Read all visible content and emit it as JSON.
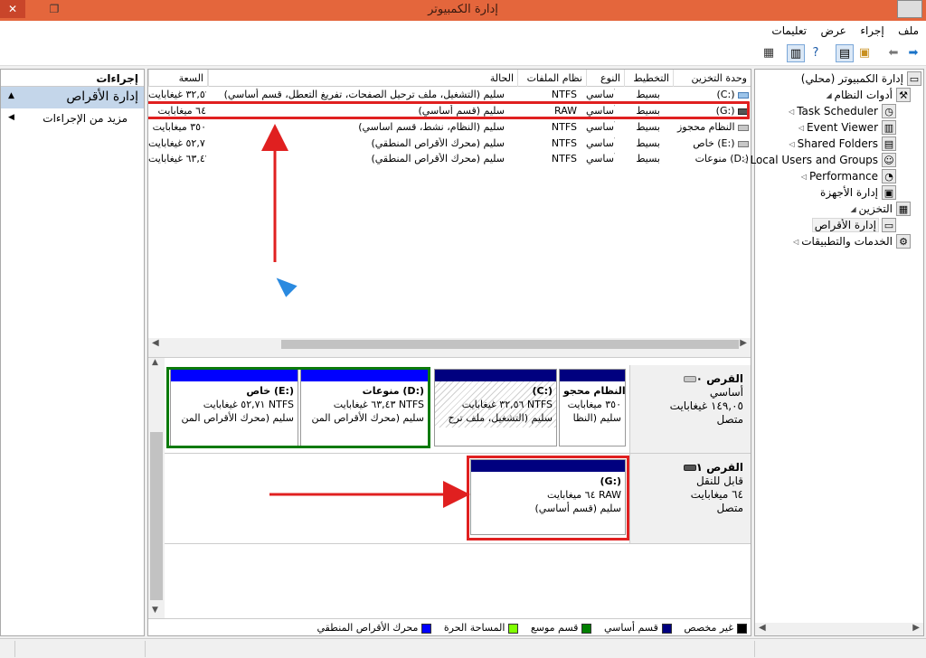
{
  "window": {
    "title": "إدارة الكمبيوتر",
    "close_glyph": "✕",
    "restore_glyph": "❐"
  },
  "menu": [
    "ملف",
    "إجراء",
    "عرض",
    "تعليمات"
  ],
  "toolbar_icons": [
    "back-arrow-icon",
    "forward-arrow-icon",
    "up-folder-icon",
    "console-tree-icon",
    "properties-icon",
    "help-icon",
    "show-hide-icon",
    "settings-icon"
  ],
  "actions": {
    "header": "إجراءات",
    "group": "إدارة الأقراص",
    "more": "مزيد من الإجراءات"
  },
  "volume_table": {
    "columns": [
      "وحدة التخزين",
      "التخطيط",
      "النوع",
      "نظام الملفات",
      "الحالة",
      "السعة"
    ],
    "rows": [
      {
        "volume": "(C:)",
        "layout": "بسيط",
        "type": "أساسي",
        "fs": "NTFS",
        "status": "سليم (التشغيل، ملف ترحيل الصفحات، تفريغ التعطل، قسم أساسي)",
        "capacity": "٣٢,٥٦ غيغابايت"
      },
      {
        "volume": "(G:)",
        "layout": "بسيط",
        "type": "أساسي",
        "fs": "RAW",
        "status": "سليم (قسم أساسي)",
        "capacity": "٦٤ ميغابايت"
      },
      {
        "volume": "النظام محجوز",
        "layout": "بسيط",
        "type": "أساسي",
        "fs": "NTFS",
        "status": "سليم (النظام، نشط، قسم اساسي)",
        "capacity": "٣٥٠ ميغابايت"
      },
      {
        "volume": "خاص (E:)",
        "layout": "بسيط",
        "type": "أساسي",
        "fs": "NTFS",
        "status": "سليم (محرك الأقراص المنطقي)",
        "capacity": "٥٢,٧١ غيغابايت"
      },
      {
        "volume": "منوعات (D:)",
        "layout": "بسيط",
        "type": "أساسي",
        "fs": "NTFS",
        "status": "سليم (محرك الأقراص المنطقي)",
        "capacity": "٦٣,٤٣ غيغابايت"
      }
    ]
  },
  "disks": [
    {
      "name": "القرص ٠",
      "type": "أساسي",
      "size": "١٤٩,٠٥ غيغابايت",
      "state": "متصل",
      "partitions": [
        {
          "title": "النظام محجو",
          "size": "٣٥٠ ميغابايت",
          "status": "سليم (النظا"
        },
        {
          "title": "(C:)",
          "size": "٣٢,٥٦ غيغابايت NTFS",
          "status": "سليم (التشغيل، ملف ترح"
        },
        {
          "title": "منوعات  (D:)",
          "size": "٦٣,٤٣ غيغابايت NTFS",
          "status": "سليم (محرك الأقراص المن"
        },
        {
          "title": "خاص  (E:)",
          "size": "٥٢,٧١ غيغابايت NTFS",
          "status": "سليم (محرك الأقراص المن"
        }
      ]
    },
    {
      "name": "القرص ١",
      "type": "قابل للنقل",
      "size": "٦٤ ميغابايت",
      "state": "متصل",
      "partitions": [
        {
          "title": "(G:)",
          "size": "٦٤ ميغابايت RAW",
          "status": "سليم (قسم أساسي)"
        }
      ]
    }
  ],
  "legend": [
    {
      "label": "غير مخصص",
      "color": "#000000"
    },
    {
      "label": "قسم أساسي",
      "color": "#00007f"
    },
    {
      "label": "قسم موسع",
      "color": "#007f00"
    },
    {
      "label": "المساحة الحرة",
      "color": "#7fff00"
    },
    {
      "label": "محرك الأقراص المنطقي",
      "color": "#0000ff"
    }
  ],
  "tree": [
    {
      "label": "إدارة الكمبيوتر (محلي)",
      "icon": "computer-icon",
      "level": 0,
      "expander": ""
    },
    {
      "label": "أدوات النظام",
      "icon": "tools-icon",
      "level": 1,
      "expander": "◢"
    },
    {
      "label": "Task Scheduler",
      "icon": "clock-icon",
      "level": 2,
      "expander": "◁"
    },
    {
      "label": "Event Viewer",
      "icon": "event-viewer-icon",
      "level": 2,
      "expander": "◁"
    },
    {
      "label": "Shared Folders",
      "icon": "shared-folder-icon",
      "level": 2,
      "expander": "◁"
    },
    {
      "label": "Local Users and Groups",
      "icon": "users-icon",
      "level": 2,
      "expander": "◁"
    },
    {
      "label": "Performance",
      "icon": "performance-icon",
      "level": 2,
      "expander": "◁"
    },
    {
      "label": "إدارة الأجهزة",
      "icon": "device-manager-icon",
      "level": 2,
      "expander": ""
    },
    {
      "label": "التخزين",
      "icon": "storage-icon",
      "level": 1,
      "expander": "◢"
    },
    {
      "label": "إدارة الأقراص",
      "icon": "disk-management-icon",
      "level": 2,
      "expander": "",
      "selected": true
    },
    {
      "label": "الخدمات والتطبيقات",
      "icon": "services-icon",
      "level": 1,
      "expander": "◁"
    }
  ]
}
